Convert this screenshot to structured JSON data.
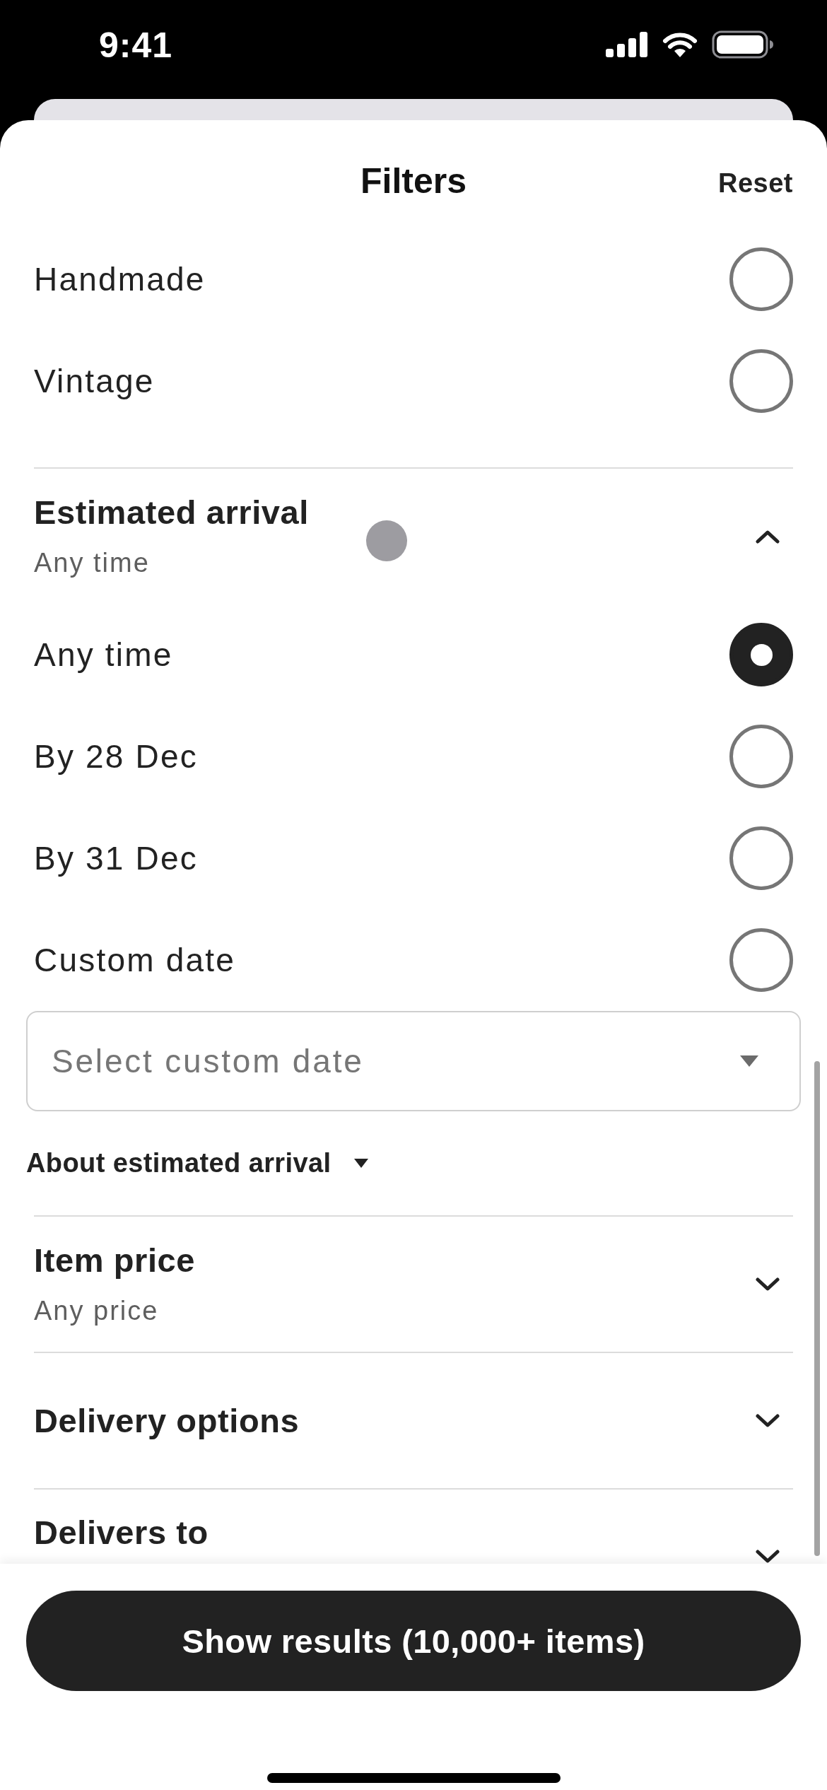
{
  "status_bar": {
    "time": "9:41"
  },
  "header": {
    "title": "Filters",
    "reset": "Reset"
  },
  "top_options": [
    {
      "label": "Handmade",
      "selected": false
    },
    {
      "label": "Vintage",
      "selected": false
    }
  ],
  "sections": [
    {
      "title": "Estimated arrival",
      "summary": "Any time",
      "expanded": true,
      "options": [
        {
          "label": "Any time",
          "selected": true
        },
        {
          "label": "By 28 Dec",
          "selected": false
        },
        {
          "label": "By 31 Dec",
          "selected": false
        },
        {
          "label": "Custom date",
          "selected": false
        }
      ],
      "custom_date": {
        "placeholder": "Select custom date"
      },
      "about": {
        "label": "About estimated arrival",
        "expanded": false
      }
    },
    {
      "title": "Item price",
      "summary": "Any price",
      "expanded": false
    },
    {
      "title": "Delivery options",
      "expanded": false
    },
    {
      "title": "Delivers to",
      "expanded": false
    }
  ],
  "footer": {
    "button": "Show results (10,000+ items)"
  }
}
